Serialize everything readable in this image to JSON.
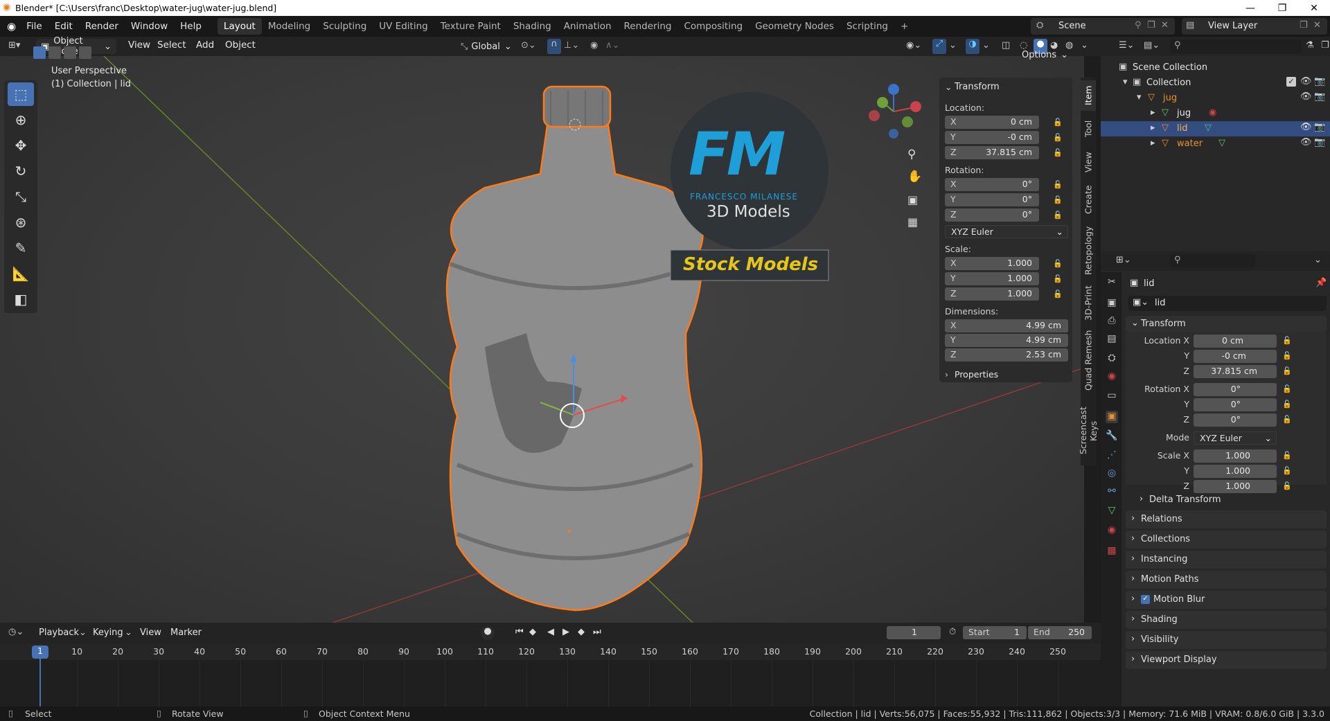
{
  "window": {
    "title": "Blender* [C:\\Users\\franc\\Desktop\\water-jug\\water-jug.blend]",
    "minimize": "—",
    "maximize": "❐",
    "close": "✕"
  },
  "menus": [
    "File",
    "Edit",
    "Render",
    "Window",
    "Help"
  ],
  "workspaces": [
    "Layout",
    "Modeling",
    "Sculpting",
    "UV Editing",
    "Texture Paint",
    "Shading",
    "Animation",
    "Rendering",
    "Compositing",
    "Geometry Nodes",
    "Scripting",
    "+"
  ],
  "active_workspace": "Layout",
  "scene": {
    "label": "Scene",
    "view_layer": "View Layer"
  },
  "viewport_header": {
    "mode": "Object Mode",
    "menus": [
      "View",
      "Select",
      "Add",
      "Object"
    ],
    "orientation": "Global",
    "options": "Options"
  },
  "viewport": {
    "perspective": "User Perspective",
    "collection": "(1) Collection | lid",
    "watermark": {
      "logo": "FM",
      "name": "FRANCESCO MILANESE",
      "sub": "3D Models",
      "banner": "Stock Models"
    }
  },
  "npanel": {
    "header": "Transform",
    "location_label": "Location:",
    "location": [
      {
        "axis": "X",
        "value": "0 cm"
      },
      {
        "axis": "Y",
        "value": "-0 cm"
      },
      {
        "axis": "Z",
        "value": "37.815 cm"
      }
    ],
    "rotation_label": "Rotation:",
    "rotation": [
      {
        "axis": "X",
        "value": "0°"
      },
      {
        "axis": "Y",
        "value": "0°"
      },
      {
        "axis": "Z",
        "value": "0°"
      }
    ],
    "rotation_mode": "XYZ Euler",
    "scale_label": "Scale:",
    "scale": [
      {
        "axis": "X",
        "value": "1.000"
      },
      {
        "axis": "Y",
        "value": "1.000"
      },
      {
        "axis": "Z",
        "value": "1.000"
      }
    ],
    "dimensions_label": "Dimensions:",
    "dimensions": [
      {
        "axis": "X",
        "value": "4.99 cm"
      },
      {
        "axis": "Y",
        "value": "4.99 cm"
      },
      {
        "axis": "Z",
        "value": "2.53 cm"
      }
    ],
    "properties": "Properties",
    "tabs": [
      "Item",
      "Tool",
      "View",
      "Create",
      "Retopology",
      "3D-Print",
      "Quad Remesh",
      "Screencast Keys"
    ]
  },
  "outliner": {
    "items": [
      {
        "name": "Scene Collection"
      },
      {
        "name": "Collection"
      },
      {
        "name": "jug"
      },
      {
        "name": "jug"
      },
      {
        "name": "lid"
      },
      {
        "name": "water"
      }
    ]
  },
  "properties": {
    "object_name": "lid",
    "object_field": "lid",
    "transform": "Transform",
    "rows": [
      {
        "label": "Location X",
        "value": "0 cm"
      },
      {
        "label": "Y",
        "value": "-0 cm"
      },
      {
        "label": "Z",
        "value": "37.815 cm"
      },
      {
        "label": "Rotation X",
        "value": "0°"
      },
      {
        "label": "Y",
        "value": "0°"
      },
      {
        "label": "Z",
        "value": "0°"
      },
      {
        "label": "Mode",
        "value": "XYZ Euler"
      },
      {
        "label": "Scale X",
        "value": "1.000"
      },
      {
        "label": "Y",
        "value": "1.000"
      },
      {
        "label": "Z",
        "value": "1.000"
      }
    ],
    "sections": [
      "Delta Transform",
      "Relations",
      "Collections",
      "Instancing",
      "Motion Paths",
      "Motion Blur",
      "Shading",
      "Visibility",
      "Viewport Display"
    ]
  },
  "timeline": {
    "menus": [
      "Playback",
      "Keying",
      "View",
      "Marker"
    ],
    "current_frame": "1",
    "start_label": "Start",
    "start": "1",
    "end_label": "End",
    "end": "250",
    "ruler": [
      "1",
      "10",
      "20",
      "30",
      "40",
      "50",
      "60",
      "70",
      "80",
      "90",
      "100",
      "110",
      "120",
      "130",
      "140",
      "150",
      "160",
      "170",
      "180",
      "190",
      "200",
      "210",
      "220",
      "230",
      "240",
      "250"
    ]
  },
  "statusbar": {
    "select": "Select",
    "rotate": "Rotate View",
    "context": "Object Context Menu",
    "info": "Collection | lid | Verts:56,075 | Faces:55,932 | Tris:111,862 | Objects:3/3 | Memory: 71.6 MiB | VRAM: 0.8/6.0 GiB | 3.3.0"
  },
  "colors": {
    "accent": "#4772b3",
    "selection": "#ff7a18",
    "fm_blue": "#1e9fd8",
    "banner_yellow": "#e6c619"
  }
}
